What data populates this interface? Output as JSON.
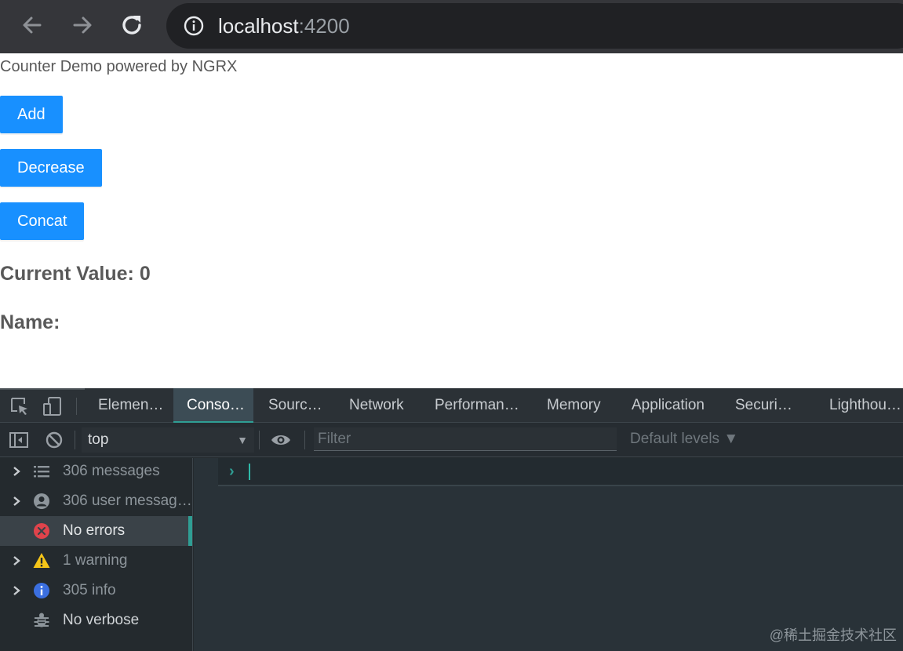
{
  "browser": {
    "url_host": "localhost",
    "url_port": ":4200",
    "icons": [
      "back-icon",
      "forward-icon",
      "reload-icon",
      "site-info-icon"
    ]
  },
  "page": {
    "title": "Counter Demo powered by NGRX",
    "buttons": {
      "add": "Add",
      "decrease": "Decrease",
      "concat": "Concat"
    },
    "current_value": "Current Value: 0",
    "name": "Name:",
    "accent_color": "#1890ff"
  },
  "devtools": {
    "tabs": [
      "Elemen…",
      "Conso…",
      "Sourc…",
      "Network",
      "Performan…",
      "Memory",
      "Application",
      "Securi…",
      "Lighthou…"
    ],
    "active_tab": "Conso…",
    "context": "top",
    "filter_placeholder": "Filter",
    "levels": "Default levels ▼",
    "sidebar": [
      {
        "label": "306 messages",
        "icon": "list-icon"
      },
      {
        "label": "306 user messag…",
        "icon": "user-icon"
      },
      {
        "label": "No errors",
        "icon": "error-icon"
      },
      {
        "label": "1 warning",
        "icon": "warning-icon"
      },
      {
        "label": "305 info",
        "icon": "info-icon"
      },
      {
        "label": "No verbose",
        "icon": "bug-icon"
      }
    ],
    "prompt": "›"
  },
  "watermark": "@稀土掘金技术社区"
}
